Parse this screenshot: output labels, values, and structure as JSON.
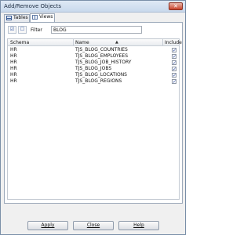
{
  "window": {
    "title": "Add/Remove Objects",
    "close_icon": "close-icon"
  },
  "tabs": [
    {
      "label": "Tables",
      "icon": "table-icon",
      "active": false
    },
    {
      "label": "Views",
      "icon": "view-icon",
      "active": true
    }
  ],
  "toolbar": {
    "select_all_icon": "select-all-icon",
    "deselect_all_icon": "deselect-all-icon"
  },
  "filter": {
    "label": "Filter",
    "value": "BLOG"
  },
  "grid": {
    "columns": [
      "Schema",
      "Name",
      "Include"
    ],
    "sort_column": "Name",
    "rows": [
      {
        "schema": "HR",
        "name": "TJS_BLOG_COUNTRIES",
        "include": true
      },
      {
        "schema": "HR",
        "name": "TJS_BLOG_EMPLOYEES",
        "include": true
      },
      {
        "schema": "HR",
        "name": "TJS_BLOG_JOB_HISTORY",
        "include": true
      },
      {
        "schema": "HR",
        "name": "TJS_BLOG_JOBS",
        "include": true
      },
      {
        "schema": "HR",
        "name": "TJS_BLOG_LOCATIONS",
        "include": true
      },
      {
        "schema": "HR",
        "name": "TJS_BLOG_REGIONS",
        "include": true
      }
    ]
  },
  "buttons": {
    "apply": "Apply",
    "close": "Close",
    "help": "Help"
  }
}
